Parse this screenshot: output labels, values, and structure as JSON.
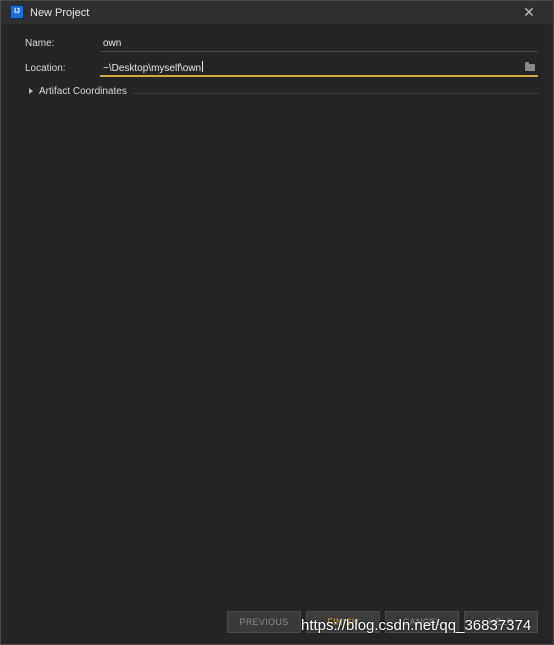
{
  "titlebar": {
    "app_icon_text": "IJ",
    "title": "New Project",
    "close_icon": "close-icon"
  },
  "form": {
    "name_label": "Name:",
    "name_value": "own",
    "location_label": "Location:",
    "location_value": "~\\Desktop\\myself\\own",
    "browse_icon": "folder-icon"
  },
  "artifact": {
    "expand_icon": "chevron-right-icon",
    "label": "Artifact Coordinates"
  },
  "buttons": {
    "previous": "PREVIOUS",
    "finish": "FINISH",
    "cancel": "CANCEL",
    "help": "HELP"
  },
  "watermark": "https://blog.csdn.net/qq_36837374",
  "colors": {
    "accent": "#d8a642",
    "background": "#252527"
  }
}
